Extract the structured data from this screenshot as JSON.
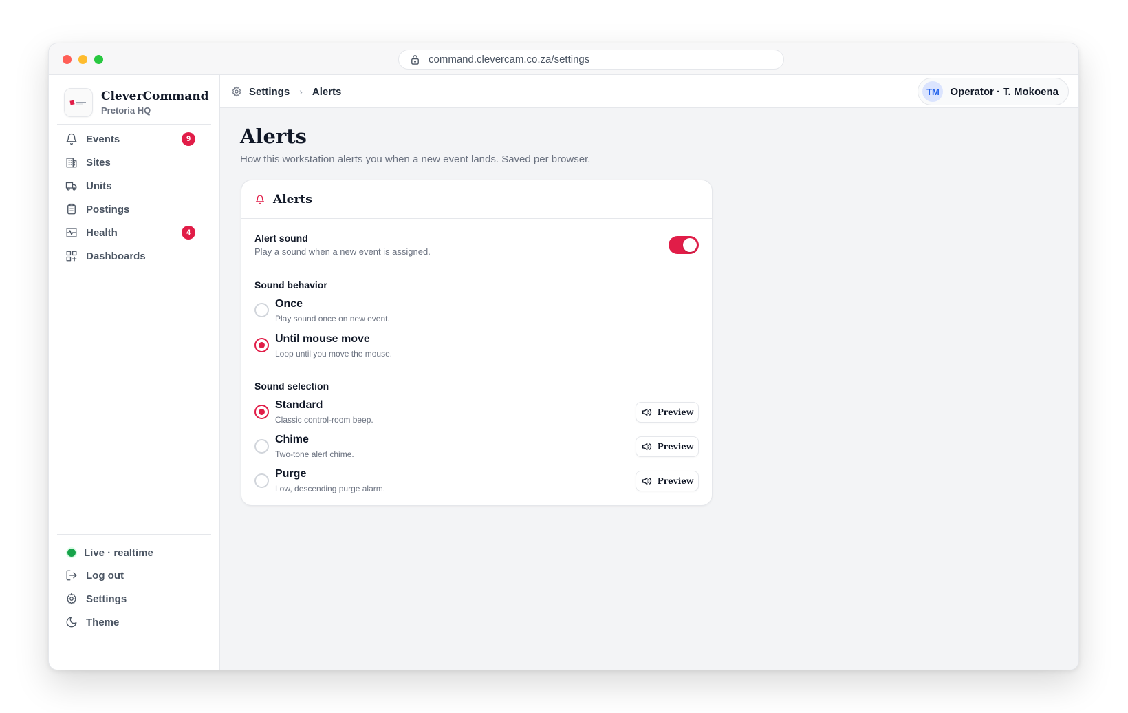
{
  "browser": {
    "url": "command.clevercam.co.za/settings"
  },
  "sidebar": {
    "brand_name": "CleverCommand",
    "brand_sub": "Pretoria HQ",
    "nav": [
      {
        "label": "Events",
        "icon": "bell-icon",
        "badge": "9"
      },
      {
        "label": "Sites",
        "icon": "building-icon",
        "badge": ""
      },
      {
        "label": "Units",
        "icon": "truck-icon",
        "badge": ""
      },
      {
        "label": "Postings",
        "icon": "clipboard-icon",
        "badge": ""
      },
      {
        "label": "Health",
        "icon": "activity-icon",
        "badge": "4"
      },
      {
        "label": "Dashboards",
        "icon": "grid-plus-icon",
        "badge": ""
      }
    ],
    "footer": {
      "status": "Live · realtime",
      "logout": "Log out",
      "settings": "Settings",
      "theme": "Theme"
    }
  },
  "topbar": {
    "breadcrumb": [
      "Settings",
      "Alerts"
    ],
    "user_initials": "TM",
    "user_name": "Operator · T. Mokoena"
  },
  "page": {
    "title": "Alerts",
    "subtitle": "How this workstation alerts you when a new event lands. Saved per browser."
  },
  "card": {
    "title": "Alerts",
    "alert_sound": {
      "title": "Alert sound",
      "description": "Play a sound when a new event is assigned.",
      "enabled": true
    },
    "behavior": {
      "heading": "Sound behavior",
      "options": [
        {
          "title": "Once",
          "description": "Play sound once on new event.",
          "selected": false
        },
        {
          "title": "Until mouse move",
          "description": "Loop until you move the mouse.",
          "selected": true
        }
      ]
    },
    "selection": {
      "heading": "Sound selection",
      "preview_label": "Preview",
      "options": [
        {
          "title": "Standard",
          "description": "Classic control-room beep.",
          "selected": true
        },
        {
          "title": "Chime",
          "description": "Two-tone alert chime.",
          "selected": false
        },
        {
          "title": "Purge",
          "description": "Low, descending purge alarm.",
          "selected": false
        }
      ]
    }
  },
  "colors": {
    "accent": "#e11d48",
    "live": "#16a34a",
    "avatar_bg": "#dbe4fe",
    "avatar_text": "#2563eb"
  }
}
